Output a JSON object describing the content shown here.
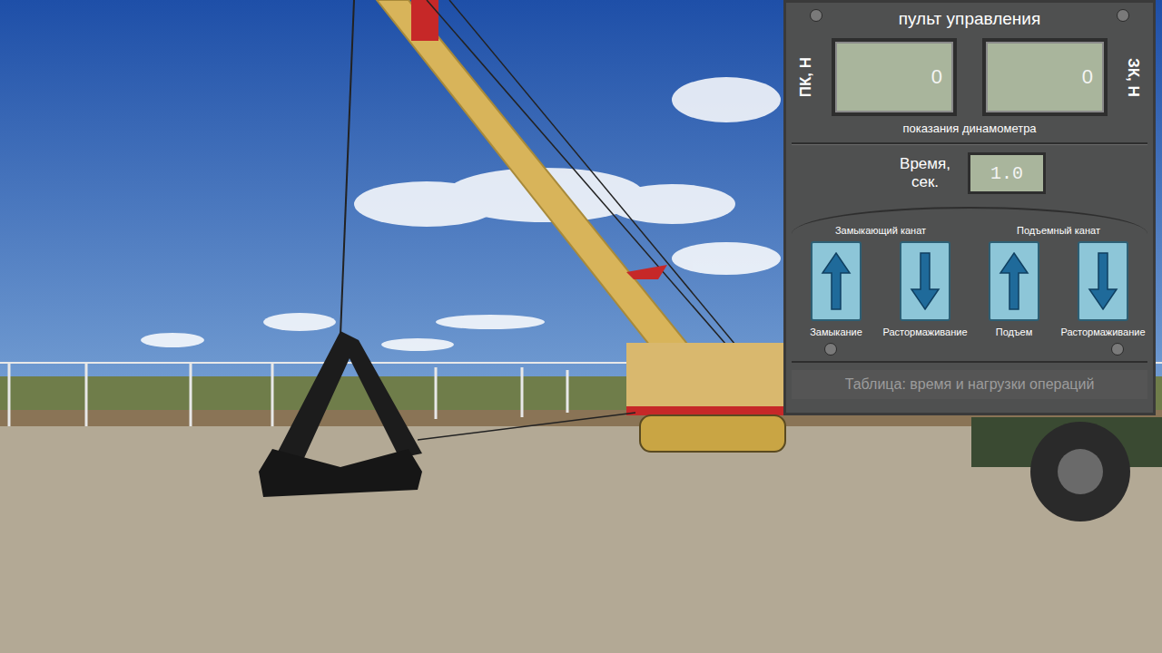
{
  "panel": {
    "title": "пульт управления",
    "dynamometers": {
      "caption": "показания динамометра",
      "left": {
        "label": "ПК, Н",
        "value": "0"
      },
      "right": {
        "label": "ЗК, Н",
        "value": "0"
      }
    },
    "time": {
      "label": "Время, сек.",
      "value": "1.0"
    },
    "groups": [
      {
        "title": "Замыкающий канат",
        "buttons": [
          {
            "label": "Замыкание",
            "kind": "up"
          },
          {
            "label": "Растормаживание",
            "kind": "down"
          }
        ]
      },
      {
        "title": "Подъемный канат",
        "buttons": [
          {
            "label": "Подъем",
            "kind": "up"
          },
          {
            "label": "Растормаживание",
            "kind": "down"
          }
        ]
      }
    ],
    "table_button": "Таблица: время и нагрузки операций"
  }
}
